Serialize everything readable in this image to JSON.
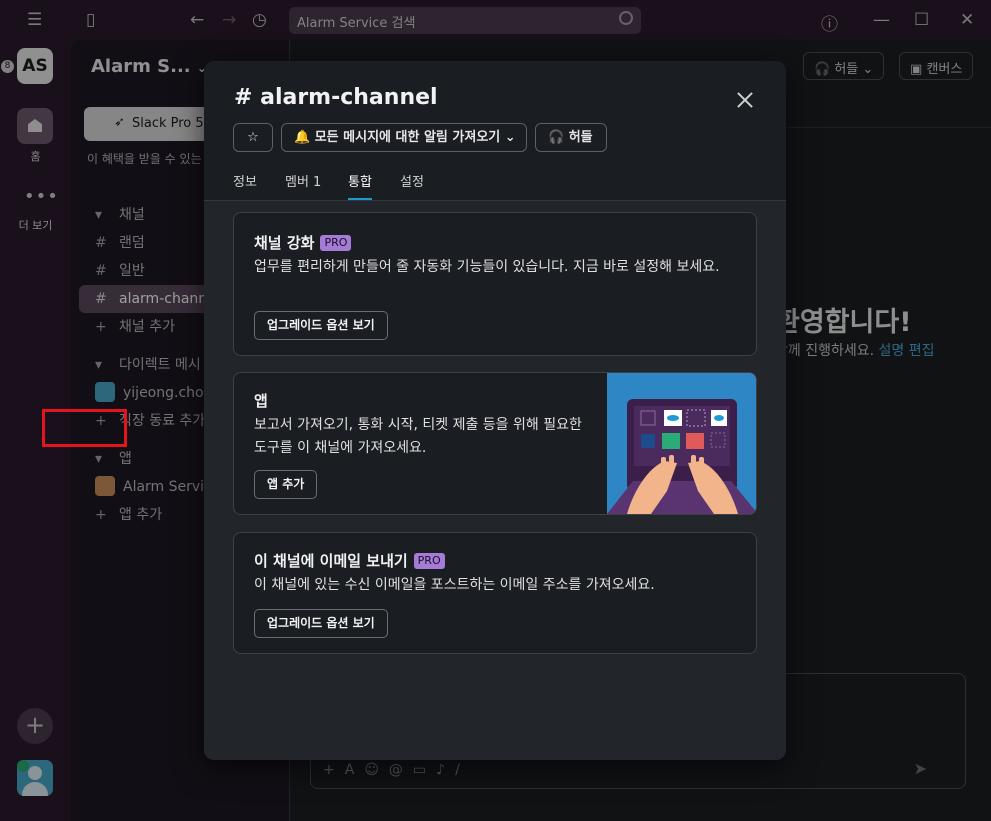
{
  "titlebar": {
    "search_text": "Alarm Service 검색"
  },
  "rail": {
    "workspace_initials": "AS",
    "badge": "8",
    "home_label": "홈",
    "more_label": "더 보기"
  },
  "sidebar": {
    "workspace_name": "Alarm S...",
    "upgrade_label": "Slack Pro 50",
    "upgrade_note": "이 혜택을 받을 수 있는 기",
    "channels_header": "채널",
    "channels": [
      "랜덤",
      "일반",
      "alarm-channel"
    ],
    "add_channel": "채널 추가",
    "dm_header": "다이렉트 메시",
    "dm_user": "yijeong.choi",
    "add_coworker": "직장 동료 추가",
    "apps_header": "앱",
    "app_item": "Alarm Service",
    "add_app": "앱 추가"
  },
  "main": {
    "huddle_label": "허들",
    "canvas_label": "캔버스",
    "welcome": "환영합니다!",
    "welcome_sub": "함께 진행하세요.",
    "welcome_link": "설명 편집"
  },
  "modal": {
    "title": "# alarm-channel",
    "notify_button": "모든 메시지에 대한 알림 가져오기",
    "huddle_button": "허들",
    "tabs": [
      "정보",
      "멤버 1",
      "통합",
      "설정"
    ],
    "active_tab": "통합",
    "cards": {
      "enhance": {
        "title": "채널 강화",
        "badge": "PRO",
        "text": "업무를 편리하게 만들어 줄 자동화 기능들이 있습니다. 지금 바로 설정해 보세요.",
        "button": "업그레이드 옵션 보기"
      },
      "apps": {
        "title": "앱",
        "text": "보고서 가져오기, 통화 시작, 티켓 제출 등을 위해 필요한 도구를 이 채널에 가져오세요.",
        "button": "앱 추가"
      },
      "email": {
        "title": "이 채널에 이메일 보내기",
        "badge": "PRO",
        "text": "이 채널에 있는 수신 이메일을 포스트하는 이메일 주소를 가져오세요.",
        "button": "업그레이드 옵션 보기"
      }
    }
  },
  "colors": {
    "aubergine": "#2a1b2c",
    "pro_badge": "#a57bd6",
    "highlight": "#e3141e",
    "tab_underline": "#1d9bd1"
  }
}
